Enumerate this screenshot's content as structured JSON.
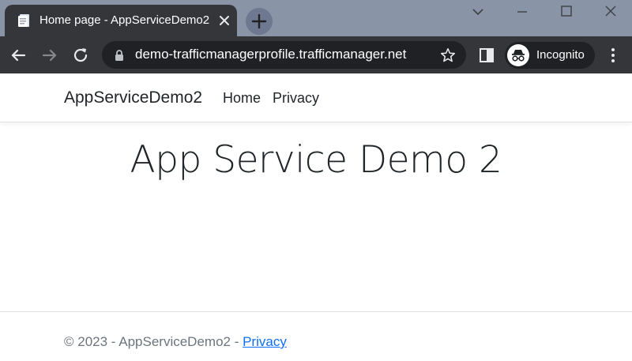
{
  "browser": {
    "tab": {
      "title": "Home page - AppServiceDemo2",
      "favicon": "page-icon"
    },
    "new_tab_icon": "plus-icon",
    "window_controls": [
      "chevron-down-icon",
      "minimize-icon",
      "maximize-icon",
      "close-icon"
    ],
    "toolbar": {
      "back_icon": "back-arrow-icon",
      "forward_icon": "forward-arrow-icon",
      "reload_icon": "reload-icon",
      "url": "demo-trafficmanagerprofile.trafficmanager.net",
      "lock_icon": "lock-icon",
      "bookmark_icon": "star-icon",
      "side_panel_icon": "side-panel-icon",
      "profile_label": "Incognito",
      "profile_icon": "incognito-icon",
      "menu_icon": "kebab-menu-icon"
    }
  },
  "page": {
    "navbar": {
      "brand": "AppServiceDemo2",
      "links": [
        "Home",
        "Privacy"
      ]
    },
    "heading": "App Service Demo 2",
    "footer": {
      "text": "© 2023 - AppServiceDemo2 - ",
      "link": "Privacy"
    }
  },
  "colors": {
    "titlebar": "#8a94a7",
    "chrome_dark": "#35363a",
    "omnibox": "#202124",
    "link": "#0d6efd"
  }
}
